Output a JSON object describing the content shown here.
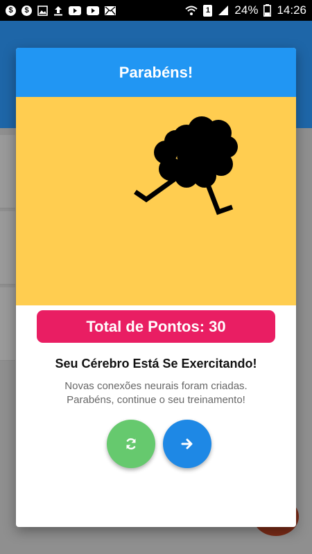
{
  "status_bar": {
    "battery": "24%",
    "time": "14:26",
    "sim_badge": "1",
    "left_icons": [
      "dollar-icon",
      "dollar-icon",
      "image-icon",
      "upload-icon",
      "youtube-icon",
      "youtube-icon",
      "mail-icon"
    ]
  },
  "dialog": {
    "title": "Parabéns!",
    "score_label": "Total de Pontos: 30",
    "heading": "Seu Cérebro Está Se Exercitando!",
    "message_line1": "Novas conexões neurais foram criadas.",
    "message_line2": "Parabéns, continue o seu treinamento!",
    "restart_icon": "refresh-icon",
    "next_icon": "arrow-right-icon"
  },
  "colors": {
    "title_bar": "#2196f3",
    "illustration_bg": "#ffcd50",
    "score_badge": "#e91e63",
    "restart_button": "#66c96e",
    "next_button": "#1e88e5"
  }
}
